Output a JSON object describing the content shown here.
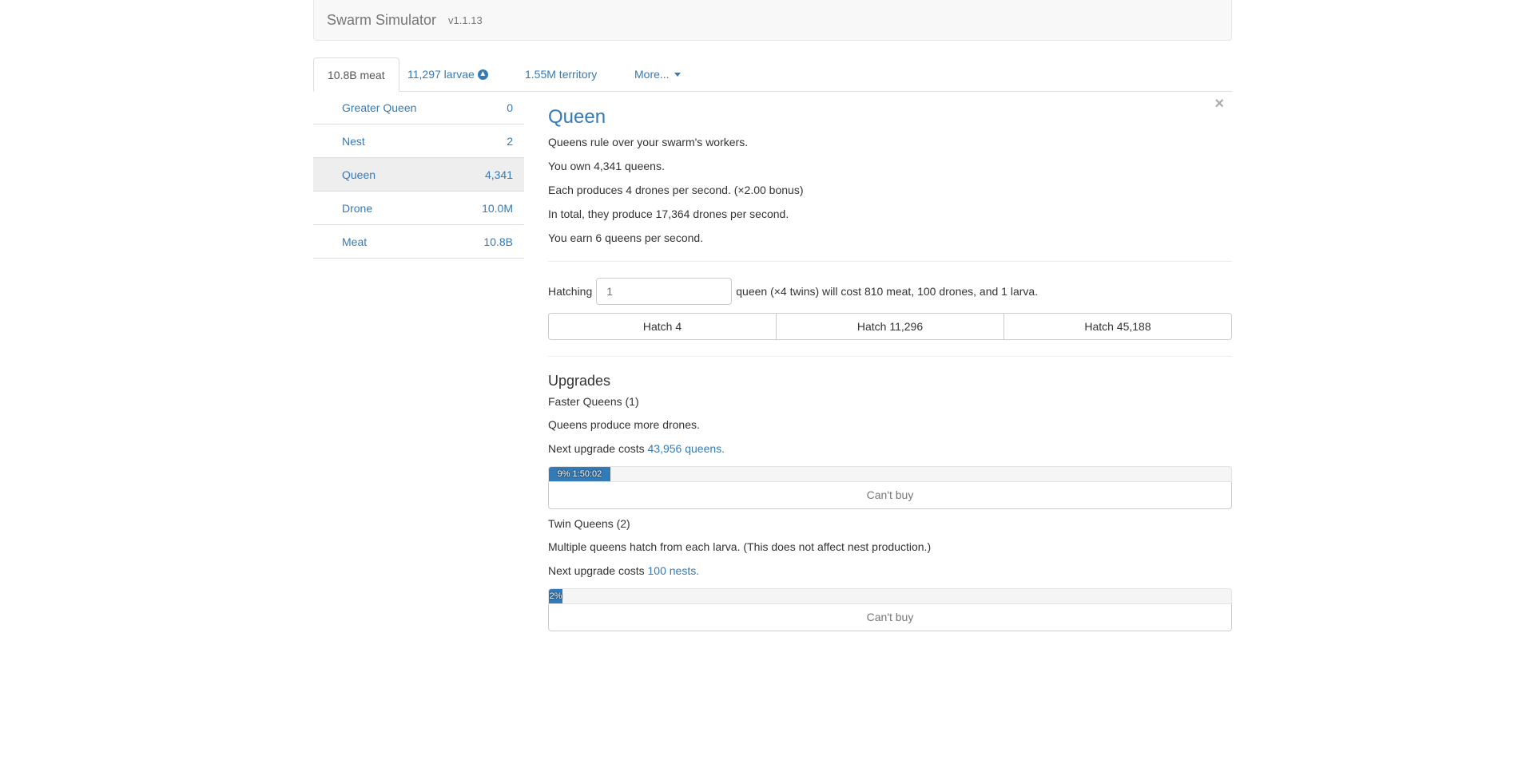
{
  "navbar": {
    "brand": "Swarm Simulator",
    "version": "v1.1.13"
  },
  "tabs": [
    {
      "label": "10.8B meat"
    },
    {
      "label": "11,297 larvae",
      "icon": "arrow-up-circle-icon"
    },
    {
      "label": "1.55M territory"
    },
    {
      "label": "More...",
      "icon": "caret-down-icon"
    }
  ],
  "sidebar": {
    "units": [
      {
        "name": "Greater Queen",
        "count": "0"
      },
      {
        "name": "Nest",
        "count": "2"
      },
      {
        "name": "Queen",
        "count": "4,341",
        "selected": true
      },
      {
        "name": "Drone",
        "count": "10.0M"
      },
      {
        "name": "Meat",
        "count": "10.8B"
      }
    ]
  },
  "main": {
    "close_label": "×",
    "title": "Queen",
    "desc": [
      "Queens rule over your swarm's workers.",
      "You own 4,341 queens.",
      "Each produces 4 drones per second. (×2.00 bonus)",
      "In total, they produce 17,364 drones per second.",
      "You earn 6 queens per second."
    ],
    "hatch": {
      "prefix": "Hatching",
      "placeholder": "1",
      "suffix": "queen (×4 twins) will cost 810 meat, 100 drones, and 1 larva.",
      "buttons": [
        "Hatch 4",
        "Hatch 11,296",
        "Hatch 45,188"
      ]
    },
    "upgrades_title": "Upgrades",
    "upgrades": [
      {
        "name": "Faster Queens (1)",
        "desc": "Queens produce more drones.",
        "cost_prefix": "Next upgrade costs",
        "cost_link": "43,956 queens.",
        "progress": 0.09,
        "progress_label": "9% 1:50:02",
        "button": "Can't buy"
      },
      {
        "name": "Twin Queens (2)",
        "desc": "Multiple queens hatch from each larva. (This does not affect nest production.)",
        "cost_prefix": "Next upgrade costs",
        "cost_link": "100 nests.",
        "progress": 0.02,
        "progress_label": "2%",
        "button": "Can't buy"
      }
    ]
  },
  "colors": {
    "accent": "#337ab7",
    "navbar_bg": "#f8f8f8",
    "selected_row": "#eeeeee"
  }
}
